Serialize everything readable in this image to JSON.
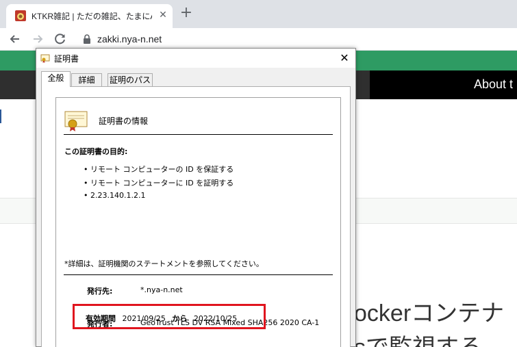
{
  "browser": {
    "tab_title": "KTKR雑記 | ただの雑記、たまにAzure",
    "tab_close_glyph": "✕",
    "new_tab_glyph": "+",
    "url": "zakki.nya-n.net",
    "icons": [
      "favicon-icon",
      "back-arrow-icon",
      "forward-arrow-icon",
      "reload-icon",
      "lock-icon"
    ]
  },
  "site": {
    "nav_about": "About t",
    "heading_line1": "ockerコンテナ",
    "heading_line2": "sで監視する"
  },
  "dialog": {
    "title": "証明書",
    "close_glyph": "✕",
    "tabs": [
      {
        "label": "全般",
        "active": true
      },
      {
        "label": "詳細",
        "active": false
      },
      {
        "label": "証明のパス",
        "active": false
      }
    ],
    "info_heading": "証明書の情報",
    "purpose_title": "この証明書の目的:",
    "purposes": [
      "• リモート コンピューターの ID を保証する",
      "• リモート コンピューターに ID を証明する",
      "• 2.23.140.1.2.1"
    ],
    "note": "*詳細は、証明機関のステートメントを参照してください。",
    "issued_to_label": "発行先:",
    "issued_to_value": "*.nya-n.net",
    "issued_by_label": "発行者:",
    "issued_by_value": "GeoTrust TLS DV RSA Mixed SHA256 2020 CA-1",
    "validity_label": "有効期間",
    "valid_from": "2021/09/25",
    "from_word": "から",
    "valid_to": "2022/10/25"
  },
  "colors": {
    "site_green": "#2e9b63",
    "site_dark": "#2f2f2f",
    "highlight_red": "#e0141e"
  }
}
